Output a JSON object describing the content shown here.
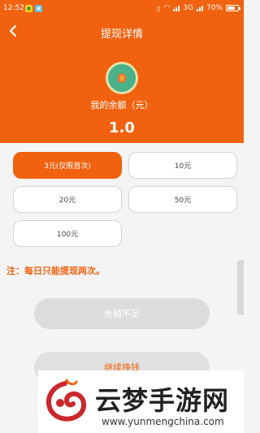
{
  "status_bar": {
    "time": "12:52",
    "network": "3G",
    "battery": "70%"
  },
  "header": {
    "title": "提现详情"
  },
  "balance": {
    "label": "我的余额（元）",
    "value": "1.0"
  },
  "options": [
    {
      "label": "3元(仅限首次)",
      "selected": true
    },
    {
      "label": "10元",
      "selected": false
    },
    {
      "label": "20元",
      "selected": false
    },
    {
      "label": "50元",
      "selected": false
    },
    {
      "label": "100元",
      "selected": false
    }
  ],
  "note": "注：每日只能提现两次。",
  "buttons": {
    "insufficient": "余额不足",
    "earn_more": "继续挣钱"
  },
  "watermark": {
    "name": "云梦手游网",
    "url": "www.yunmengchina.com"
  },
  "colors": {
    "accent": "#f0620f",
    "background": "#f4f4f4"
  },
  "icons": {
    "back": "chevron-left-icon",
    "wallet": "wallet-icon"
  }
}
